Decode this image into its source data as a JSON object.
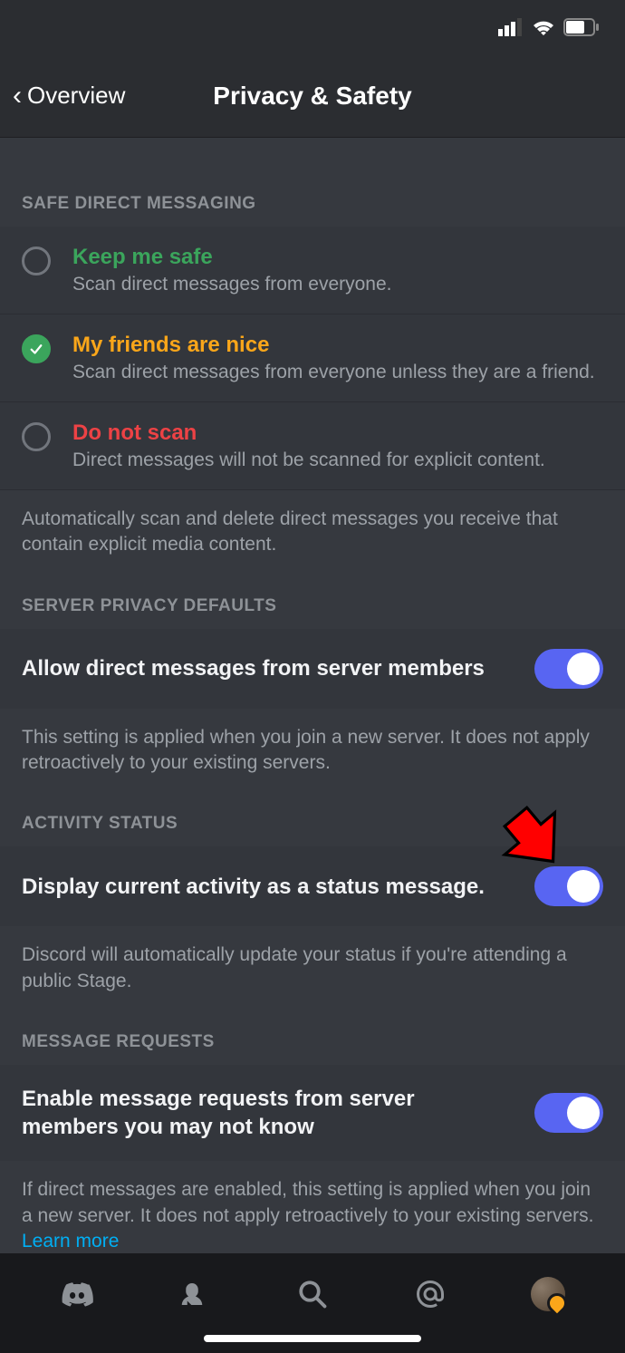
{
  "header": {
    "back_label": "Overview",
    "title": "Privacy & Safety"
  },
  "sections": {
    "sdm": {
      "header": "SAFE DIRECT MESSAGING",
      "options": [
        {
          "title": "Keep me safe",
          "sub": "Scan direct messages from everyone."
        },
        {
          "title": "My friends are nice",
          "sub": "Scan direct messages from everyone unless they are a friend."
        },
        {
          "title": "Do not scan",
          "sub": "Direct messages will not be scanned for explicit content."
        }
      ],
      "selected_index": 1,
      "desc": "Automatically scan and delete direct messages you receive that contain explicit media content."
    },
    "spd": {
      "header": "SERVER PRIVACY DEFAULTS",
      "toggle_label": "Allow direct messages from server members",
      "toggle_on": true,
      "desc": "This setting is applied when you join a new server. It does not apply retroactively to your existing servers."
    },
    "activity": {
      "header": "ACTIVITY STATUS",
      "toggle_label": "Display current activity as a status message.",
      "toggle_on": true,
      "desc": "Discord will automatically update your status if you're attending a public Stage."
    },
    "msgreq": {
      "header": "MESSAGE REQUESTS",
      "toggle_label": "Enable message requests from server members you may not know",
      "toggle_on": true,
      "desc": "If direct messages are enabled, this setting is applied when you join a new server. It does not apply retroactively to your existing servers. ",
      "learn_more": "Learn more"
    }
  }
}
